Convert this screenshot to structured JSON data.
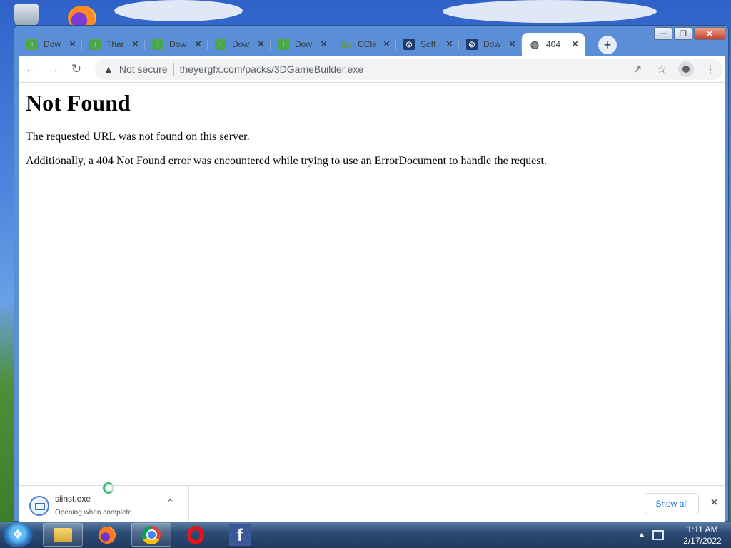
{
  "browser": {
    "tabs": [
      {
        "title": "Dow",
        "icon": "download-icon"
      },
      {
        "title": "Thar",
        "icon": "download-icon"
      },
      {
        "title": "Dow",
        "icon": "download-icon"
      },
      {
        "title": "Dow",
        "icon": "download-icon"
      },
      {
        "title": "Dow",
        "icon": "download-icon"
      },
      {
        "title": "CCle",
        "icon": "dp-logo-icon",
        "favicon_text": "dp"
      },
      {
        "title": "Soft",
        "icon": "q-logo-icon"
      },
      {
        "title": "Dow",
        "icon": "q-logo-icon"
      },
      {
        "title": "404",
        "icon": "globe-icon",
        "active": true
      }
    ],
    "address_bar": {
      "security_label": "Not secure",
      "url": "theyergfx.com/packs/3DGameBuilder.exe"
    }
  },
  "page": {
    "heading": "Not Found",
    "paragraph1": "The requested URL was not found on this server.",
    "paragraph2": "Additionally, a 404 Not Found error was encountered while trying to use an ErrorDocument to handle the request."
  },
  "download_bar": {
    "file_name": "siinst.exe",
    "status": "Opening when complete",
    "show_all_label": "Show all"
  },
  "taskbar": {
    "apps": [
      "windows-explorer",
      "firefox",
      "chrome",
      "opera",
      "facebook"
    ],
    "facebook_glyph": "f",
    "clock_time": "1:11 AM",
    "clock_date": "2/17/2022"
  },
  "colors": {
    "link_blue": "#1a73e8",
    "window_frame": "#5a8fd8"
  }
}
